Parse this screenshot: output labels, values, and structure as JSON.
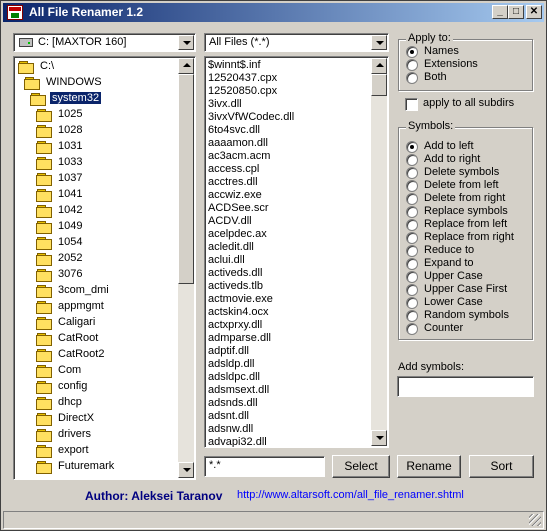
{
  "window": {
    "title": "All File Renamer 1.2",
    "minimize": "_",
    "maximize": "□",
    "close": "✕"
  },
  "drive": {
    "selected": "C: [MAXTOR 160]",
    "icon": "hard-drive-icon"
  },
  "filter": {
    "selected": "All Files (*.*)"
  },
  "tree": {
    "items": [
      {
        "label": "C:\\",
        "depth": 0,
        "open": true
      },
      {
        "label": "WINDOWS",
        "depth": 1,
        "open": true
      },
      {
        "label": "system32",
        "depth": 2,
        "open": true,
        "selected": true
      },
      {
        "label": "1025",
        "depth": 3
      },
      {
        "label": "1028",
        "depth": 3
      },
      {
        "label": "1031",
        "depth": 3
      },
      {
        "label": "1033",
        "depth": 3
      },
      {
        "label": "1037",
        "depth": 3
      },
      {
        "label": "1041",
        "depth": 3
      },
      {
        "label": "1042",
        "depth": 3
      },
      {
        "label": "1049",
        "depth": 3
      },
      {
        "label": "1054",
        "depth": 3
      },
      {
        "label": "2052",
        "depth": 3
      },
      {
        "label": "3076",
        "depth": 3
      },
      {
        "label": "3com_dmi",
        "depth": 3
      },
      {
        "label": "appmgmt",
        "depth": 3
      },
      {
        "label": "Caligari",
        "depth": 3
      },
      {
        "label": "CatRoot",
        "depth": 3
      },
      {
        "label": "CatRoot2",
        "depth": 3
      },
      {
        "label": "Com",
        "depth": 3
      },
      {
        "label": "config",
        "depth": 3
      },
      {
        "label": "dhcp",
        "depth": 3
      },
      {
        "label": "DirectX",
        "depth": 3
      },
      {
        "label": "drivers",
        "depth": 3
      },
      {
        "label": "export",
        "depth": 3
      },
      {
        "label": "Futuremark",
        "depth": 3
      }
    ]
  },
  "files": [
    "$winnt$.inf",
    "12520437.cpx",
    "12520850.cpx",
    "3ivx.dll",
    "3ivxVfWCodec.dll",
    "6to4svc.dll",
    "aaaamon.dll",
    "ac3acm.acm",
    "access.cpl",
    "acctres.dll",
    "accwiz.exe",
    "ACDSee.scr",
    "ACDV.dll",
    "acelpdec.ax",
    "acledit.dll",
    "aclui.dll",
    "activeds.dll",
    "activeds.tlb",
    "actmovie.exe",
    "actskin4.ocx",
    "actxprxy.dll",
    "admparse.dll",
    "adptif.dll",
    "adsldp.dll",
    "adsldpc.dll",
    "adsmsext.dll",
    "adsnds.dll",
    "adsnt.dll",
    "adsnw.dll",
    "advapi32.dll"
  ],
  "mask_input": {
    "value": "*.*"
  },
  "buttons": {
    "select": "Select",
    "rename": "Rename",
    "sort": "Sort"
  },
  "apply_to": {
    "title": "Apply to:",
    "options": [
      {
        "label": "Names",
        "checked": true
      },
      {
        "label": "Extensions",
        "checked": false
      },
      {
        "label": "Both",
        "checked": false
      }
    ],
    "subdirs_label": "apply to all subdirs",
    "subdirs_checked": false
  },
  "symbols": {
    "title": "Symbols:",
    "options": [
      {
        "label": "Add to left",
        "checked": true
      },
      {
        "label": "Add to right",
        "checked": false
      },
      {
        "label": "Delete symbols",
        "checked": false
      },
      {
        "label": "Delete from left",
        "checked": false
      },
      {
        "label": "Delete from right",
        "checked": false
      },
      {
        "label": "Replace symbols",
        "checked": false
      },
      {
        "label": "Replace from left",
        "checked": false
      },
      {
        "label": "Replace from right",
        "checked": false
      },
      {
        "label": "Reduce to",
        "checked": false
      },
      {
        "label": "Expand to",
        "checked": false
      },
      {
        "label": "Upper Case",
        "checked": false
      },
      {
        "label": "Upper Case First",
        "checked": false
      },
      {
        "label": "Lower Case",
        "checked": false
      },
      {
        "label": "Random symbols",
        "checked": false
      },
      {
        "label": "Counter",
        "checked": false
      }
    ]
  },
  "add_symbols": {
    "label": "Add symbols:",
    "value": ""
  },
  "footer": {
    "author": "Author: Aleksei Taranov",
    "url": "http://www.altarsoft.com/all_file_renamer.shtml"
  },
  "colors": {
    "title_start": "#0a246a",
    "selection": "#0a246a",
    "author": "#000080",
    "link": "#0000ff"
  }
}
